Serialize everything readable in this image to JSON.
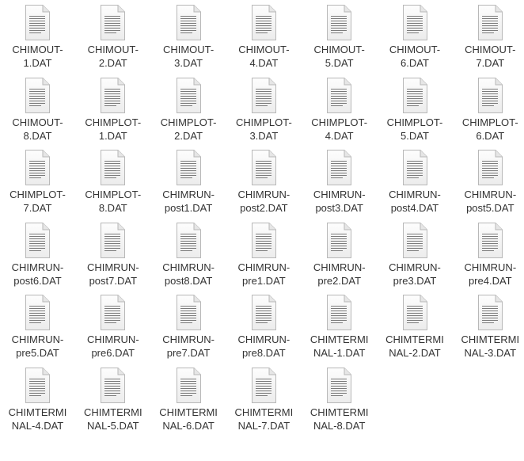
{
  "files": [
    {
      "name_lines": [
        "CHIMOUT-",
        "1.DAT"
      ],
      "icon": "text-document-icon"
    },
    {
      "name_lines": [
        "CHIMOUT-",
        "2.DAT"
      ],
      "icon": "text-document-icon"
    },
    {
      "name_lines": [
        "CHIMOUT-",
        "3.DAT"
      ],
      "icon": "text-document-icon"
    },
    {
      "name_lines": [
        "CHIMOUT-",
        "4.DAT"
      ],
      "icon": "text-document-icon"
    },
    {
      "name_lines": [
        "CHIMOUT-",
        "5.DAT"
      ],
      "icon": "text-document-icon"
    },
    {
      "name_lines": [
        "CHIMOUT-",
        "6.DAT"
      ],
      "icon": "text-document-icon"
    },
    {
      "name_lines": [
        "CHIMOUT-",
        "7.DAT"
      ],
      "icon": "text-document-icon"
    },
    {
      "name_lines": [
        "CHIMOUT-",
        "8.DAT"
      ],
      "icon": "text-document-icon"
    },
    {
      "name_lines": [
        "CHIMPLOT-",
        "1.DAT"
      ],
      "icon": "text-document-icon"
    },
    {
      "name_lines": [
        "CHIMPLOT-",
        "2.DAT"
      ],
      "icon": "text-document-icon"
    },
    {
      "name_lines": [
        "CHIMPLOT-",
        "3.DAT"
      ],
      "icon": "text-document-icon"
    },
    {
      "name_lines": [
        "CHIMPLOT-",
        "4.DAT"
      ],
      "icon": "text-document-icon"
    },
    {
      "name_lines": [
        "CHIMPLOT-",
        "5.DAT"
      ],
      "icon": "text-document-icon"
    },
    {
      "name_lines": [
        "CHIMPLOT-",
        "6.DAT"
      ],
      "icon": "text-document-icon"
    },
    {
      "name_lines": [
        "CHIMPLOT-",
        "7.DAT"
      ],
      "icon": "text-document-icon"
    },
    {
      "name_lines": [
        "CHIMPLOT-",
        "8.DAT"
      ],
      "icon": "text-document-icon"
    },
    {
      "name_lines": [
        "CHIMRUN-",
        "post1.DAT"
      ],
      "icon": "text-document-icon"
    },
    {
      "name_lines": [
        "CHIMRUN-",
        "post2.DAT"
      ],
      "icon": "text-document-icon"
    },
    {
      "name_lines": [
        "CHIMRUN-",
        "post3.DAT"
      ],
      "icon": "text-document-icon"
    },
    {
      "name_lines": [
        "CHIMRUN-",
        "post4.DAT"
      ],
      "icon": "text-document-icon"
    },
    {
      "name_lines": [
        "CHIMRUN-",
        "post5.DAT"
      ],
      "icon": "text-document-icon"
    },
    {
      "name_lines": [
        "CHIMRUN-",
        "post6.DAT"
      ],
      "icon": "text-document-icon"
    },
    {
      "name_lines": [
        "CHIMRUN-",
        "post7.DAT"
      ],
      "icon": "text-document-icon"
    },
    {
      "name_lines": [
        "CHIMRUN-",
        "post8.DAT"
      ],
      "icon": "text-document-icon"
    },
    {
      "name_lines": [
        "CHIMRUN-",
        "pre1.DAT"
      ],
      "icon": "text-document-icon"
    },
    {
      "name_lines": [
        "CHIMRUN-",
        "pre2.DAT"
      ],
      "icon": "text-document-icon"
    },
    {
      "name_lines": [
        "CHIMRUN-",
        "pre3.DAT"
      ],
      "icon": "text-document-icon"
    },
    {
      "name_lines": [
        "CHIMRUN-",
        "pre4.DAT"
      ],
      "icon": "text-document-icon"
    },
    {
      "name_lines": [
        "CHIMRUN-",
        "pre5.DAT"
      ],
      "icon": "text-document-icon"
    },
    {
      "name_lines": [
        "CHIMRUN-",
        "pre6.DAT"
      ],
      "icon": "text-document-icon"
    },
    {
      "name_lines": [
        "CHIMRUN-",
        "pre7.DAT"
      ],
      "icon": "text-document-icon"
    },
    {
      "name_lines": [
        "CHIMRUN-",
        "pre8.DAT"
      ],
      "icon": "text-document-icon"
    },
    {
      "name_lines": [
        "CHIMTERMI",
        "NAL-1.DAT"
      ],
      "icon": "text-document-icon"
    },
    {
      "name_lines": [
        "CHIMTERMI",
        "NAL-2.DAT"
      ],
      "icon": "text-document-icon"
    },
    {
      "name_lines": [
        "CHIMTERMI",
        "NAL-3.DAT"
      ],
      "icon": "text-document-icon"
    },
    {
      "name_lines": [
        "CHIMTERMI",
        "NAL-4.DAT"
      ],
      "icon": "text-document-icon"
    },
    {
      "name_lines": [
        "CHIMTERMI",
        "NAL-5.DAT"
      ],
      "icon": "text-document-icon"
    },
    {
      "name_lines": [
        "CHIMTERMI",
        "NAL-6.DAT"
      ],
      "icon": "text-document-icon"
    },
    {
      "name_lines": [
        "CHIMTERMI",
        "NAL-7.DAT"
      ],
      "icon": "text-document-icon"
    },
    {
      "name_lines": [
        "CHIMTERMI",
        "NAL-8.DAT"
      ],
      "icon": "text-document-icon"
    }
  ]
}
